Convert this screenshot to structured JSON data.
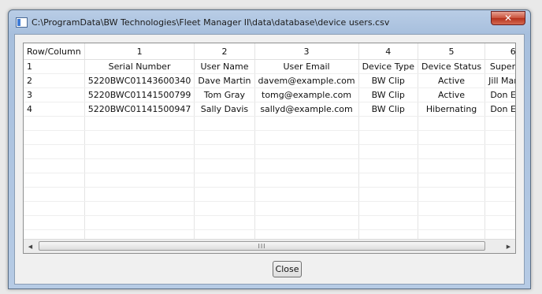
{
  "window": {
    "title": "C:\\ProgramData\\BW Technologies\\Fleet Manager II\\data\\database\\device users.csv",
    "close_glyph": "✕"
  },
  "grid": {
    "header": [
      "Row/Column",
      "1",
      "2",
      "3",
      "4",
      "5",
      "6"
    ],
    "rows": [
      [
        "1",
        "Serial Number",
        "User Name",
        "User Email",
        "Device Type",
        "Device Status",
        "Supervisor"
      ],
      [
        "2",
        "5220BWC01143600340",
        "Dave Martin",
        "davem@example.com",
        "BW Clip",
        "Active",
        "Jill Marshall"
      ],
      [
        "3",
        "5220BWC01141500799",
        "Tom Gray",
        "tomg@example.com",
        "BW Clip",
        "Active",
        "Don Edgar"
      ],
      [
        "4",
        "5220BWC01141500947",
        "Sally Davis",
        "sallyd@example.com",
        "BW Clip",
        "Hibernating",
        "Don Edgar"
      ],
      [
        "",
        "",
        "",
        "",
        "",
        "",
        ""
      ],
      [
        "",
        "",
        "",
        "",
        "",
        "",
        ""
      ],
      [
        "",
        "",
        "",
        "",
        "",
        "",
        ""
      ],
      [
        "",
        "",
        "",
        "",
        "",
        "",
        ""
      ],
      [
        "",
        "",
        "",
        "",
        "",
        "",
        ""
      ],
      [
        "",
        "",
        "",
        "",
        "",
        "",
        ""
      ],
      [
        "",
        "",
        "",
        "",
        "",
        "",
        ""
      ],
      [
        "",
        "",
        "",
        "",
        "",
        "",
        ""
      ],
      [
        "",
        "",
        "",
        "",
        "",
        "",
        ""
      ]
    ]
  },
  "scrollbar": {
    "left_glyph": "◀",
    "right_glyph": "▶",
    "grip": "III"
  },
  "buttons": {
    "close_label": "Close"
  }
}
